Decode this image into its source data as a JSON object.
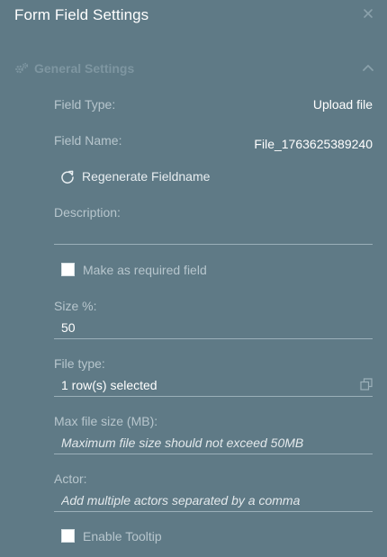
{
  "header": {
    "title": "Form Field Settings",
    "close_icon": "close-icon"
  },
  "section": {
    "title": "General Settings",
    "icon": "gears-icon",
    "collapse_icon": "chevron-up-icon"
  },
  "fields": {
    "field_type_label": "Field Type:",
    "field_type_value": "Upload file",
    "field_name_label": "Field Name:",
    "field_name_value": "File_1763625389240",
    "regenerate_label": "Regenerate Fieldname",
    "regenerate_icon": "refresh-icon",
    "description_label": "Description:",
    "description_value": "",
    "required_label": "Make as required field",
    "required_checked": false,
    "size_label": "Size %:",
    "size_value": "50",
    "file_type_label": "File type:",
    "file_type_value": "1 row(s) selected",
    "file_type_icon": "open-selector-icon",
    "max_size_label": "Max file size (MB):",
    "max_size_placeholder": "Maximum file size should not exceed 50MB",
    "actor_label": "Actor:",
    "actor_placeholder": "Add multiple actors separated by a comma",
    "tooltip_label": "Enable Tooltip",
    "tooltip_checked": false
  },
  "colors": {
    "panel_background": "#5f7a86",
    "label_text": "#b7c6cd",
    "value_text": "#ffffff",
    "section_title": "#7e96a1",
    "underline": "#9bb0b9"
  }
}
